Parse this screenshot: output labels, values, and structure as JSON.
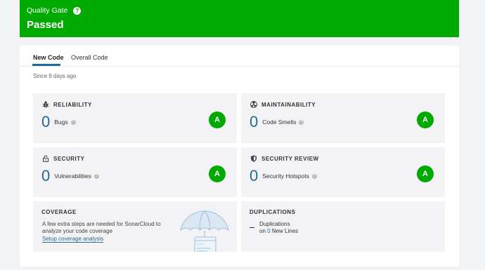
{
  "quality_gate": {
    "label": "Quality Gate",
    "help": "?",
    "status": "Passed",
    "color": "#00aa00"
  },
  "tabs": [
    {
      "label": "New Code",
      "active": true
    },
    {
      "label": "Overall Code",
      "active": false
    }
  ],
  "since": "Since 9 days ago",
  "cards": {
    "reliability": {
      "title": "RELIABILITY",
      "icon": "bug-icon",
      "value": "0",
      "label": "Bugs",
      "grade": "A"
    },
    "maintainability": {
      "title": "MAINTAINABILITY",
      "icon": "radiation-icon",
      "value": "0",
      "label": "Code Smells",
      "grade": "A"
    },
    "security": {
      "title": "SECURITY",
      "icon": "lock-icon",
      "value": "0",
      "label": "Vulnerabilities",
      "grade": "A"
    },
    "security_review": {
      "title": "SECURITY REVIEW",
      "icon": "shield-icon",
      "value": "0",
      "label": "Security Hotspots",
      "grade": "A"
    },
    "coverage": {
      "title": "COVERAGE",
      "text": "A few extra steps are needed for SonarCloud to analyze your code coverage",
      "link": "Setup coverage analysis"
    },
    "duplications": {
      "title": "DUPLICATIONS",
      "line1": "Duplications",
      "line2_prefix": "on",
      "line2_count": "0",
      "line2_suffix": "New Lines"
    }
  },
  "colors": {
    "accent": "#236a97",
    "grade": "#00aa00",
    "card_bg": "#f3f3f5"
  }
}
